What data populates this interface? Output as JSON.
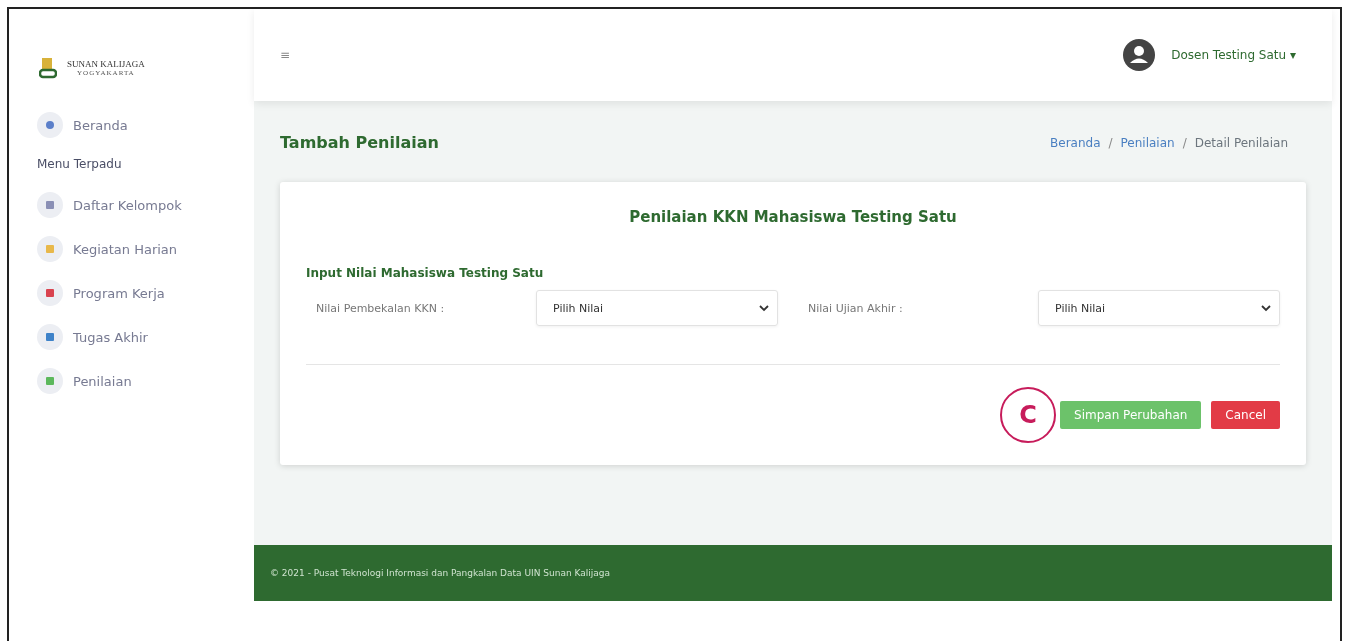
{
  "logo": {
    "name": "SUNAN KALIJAGA",
    "city": "YOGYAKARTA"
  },
  "sidebar": {
    "items": [
      {
        "label": "Beranda",
        "color": "#5b7fc9",
        "kind": "home"
      },
      {
        "label": "Menu Terpadu",
        "kind": "heading"
      },
      {
        "label": "Daftar Kelompok",
        "color": "#8a8fb5",
        "kind": "link"
      },
      {
        "label": "Kegiatan Harian",
        "color": "#e8b84a",
        "kind": "link"
      },
      {
        "label": "Program Kerja",
        "color": "#d9434f",
        "kind": "link"
      },
      {
        "label": "Tugas Akhir",
        "color": "#3f83c9",
        "kind": "link"
      },
      {
        "label": "Penilaian",
        "color": "#5cb85c",
        "kind": "link"
      }
    ]
  },
  "header": {
    "menu_icon": "≡",
    "user": "Dosen Testing Satu",
    "caret": "▾"
  },
  "page": {
    "title": "Tambah Penilaian",
    "breadcrumb_separator": "/",
    "breadcrumb": [
      {
        "label": "Beranda",
        "link": true
      },
      {
        "label": "Penilaian",
        "link": true
      },
      {
        "label": "Detail Penilaian",
        "link": false
      }
    ]
  },
  "card": {
    "title": "Penilaian KKN Mahasiswa Testing Satu",
    "section": "Input Nilai Mahasiswa Testing Satu",
    "fields": [
      {
        "label": "Nilai Pembekalan KKN :",
        "value": "Pilih Nilai"
      },
      {
        "label": "Nilai Ujian Akhir :",
        "value": "Pilih Nilai"
      }
    ],
    "callout": "C",
    "buttons": [
      {
        "label": "Simpan Perubahan",
        "kind": "primary"
      },
      {
        "label": "Cancel",
        "kind": "danger"
      }
    ]
  },
  "footer": "© 2021 - Pusat Teknologi Informasi dan Pangkalan Data UIN Sunan Kalijaga"
}
